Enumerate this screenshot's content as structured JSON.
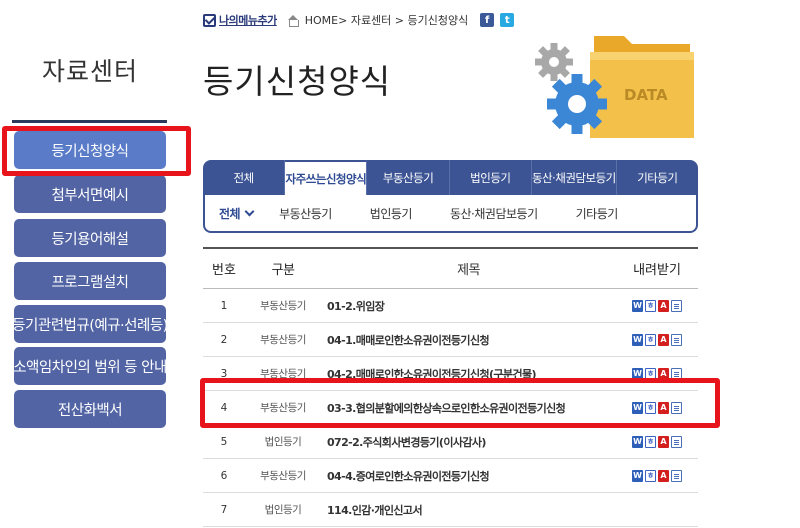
{
  "sidebar": {
    "title": "자료센터",
    "items": [
      {
        "label": "등기신청양식",
        "active": true
      },
      {
        "label": "첨부서면예시"
      },
      {
        "label": "등기용어해설"
      },
      {
        "label": "프로그램설치"
      },
      {
        "label": "등기관련법규(예규·선례등)"
      },
      {
        "label": "소액임차인의 범위 등 안내"
      },
      {
        "label": "전산화백서"
      }
    ]
  },
  "topbar": {
    "mymenu_label": "나의메뉴추가",
    "breadcrumb": "HOME> 자료센터 > 등기신청양식",
    "facebook_glyph": "f",
    "twitter_glyph": "t"
  },
  "page": {
    "title": "등기신청양식"
  },
  "illustration": {
    "text": "DATA"
  },
  "tabs": [
    {
      "label": "전체"
    },
    {
      "label": "자주쓰는신청양식",
      "active": true
    },
    {
      "label": "부동산등기"
    },
    {
      "label": "법인등기"
    },
    {
      "label": "동산·채권담보등기"
    },
    {
      "label": "기타등기"
    }
  ],
  "subtabs": [
    {
      "label": "전체",
      "active": true
    },
    {
      "label": "부동산등기"
    },
    {
      "label": "법인등기"
    },
    {
      "label": "동산·채권담보등기"
    },
    {
      "label": "기타등기"
    }
  ],
  "table": {
    "headers": {
      "no": "번호",
      "category": "구분",
      "title": "제목",
      "download": "내려받기"
    },
    "rows": [
      {
        "no": "1",
        "category": "부동산등기",
        "title": "01-2.위임장"
      },
      {
        "no": "2",
        "category": "부동산등기",
        "title": "04-1.매매로인한소유권이전등기신청"
      },
      {
        "no": "3",
        "category": "부동산등기",
        "title": "04-2.매매로인한소유권이전등기신청(구분건물)"
      },
      {
        "no": "4",
        "category": "부동산등기",
        "title": "03-3.협의분할에의한상속으로인한소유권이전등기신청"
      },
      {
        "no": "5",
        "category": "법인등기",
        "title": "072-2.주식회사변경등기(이사감사)"
      },
      {
        "no": "6",
        "category": "부동산등기",
        "title": "04-4.증여로인한소유권이전등기신청"
      },
      {
        "no": "7",
        "category": "법인등기",
        "title": "114.인감·개인신고서"
      }
    ],
    "download_icons": [
      {
        "name": "word-file-icon",
        "glyph": "W"
      },
      {
        "name": "hwp-file-icon",
        "glyph": "ㅎ"
      },
      {
        "name": "pdf-file-icon",
        "glyph": "A"
      },
      {
        "name": "document-file-icon",
        "glyph": ""
      }
    ]
  },
  "colors": {
    "sidebar_button": "#5264a4",
    "tab_bar": "#3c5494",
    "highlight": "#e8141b"
  }
}
